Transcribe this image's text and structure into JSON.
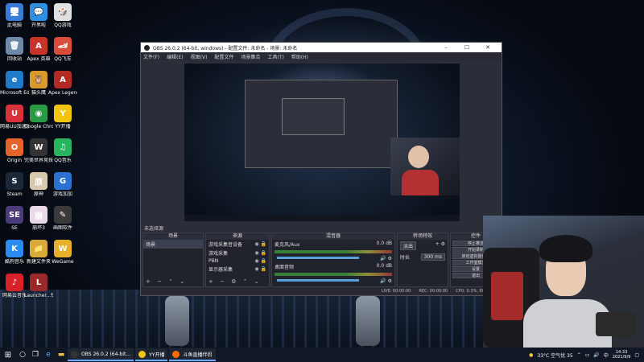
{
  "desktop": {
    "icons": [
      {
        "label": "此电脑",
        "glyph": "🖥",
        "color": "#3a7bd5"
      },
      {
        "label": "开黑啦",
        "glyph": "💬",
        "color": "#2f8fe0"
      },
      {
        "label": "QQ游戏",
        "glyph": "🎲",
        "color": "#e0e0e0"
      },
      {
        "label": "回收站",
        "glyph": "🗑",
        "color": "#6f89a8"
      },
      {
        "label": "Apex 英雄",
        "glyph": "A",
        "color": "#c8332a"
      },
      {
        "label": "QQ飞车",
        "glyph": "🏎",
        "color": "#d84c3a"
      },
      {
        "label": "Microsoft Edge",
        "glyph": "e",
        "color": "#1f7bc8"
      },
      {
        "label": "猫头鹰",
        "glyph": "🦉",
        "color": "#d89a2a"
      },
      {
        "label": "Apex Legends",
        "glyph": "A",
        "color": "#b32a24"
      },
      {
        "label": "网易UU加速器",
        "glyph": "U",
        "color": "#d8323a"
      },
      {
        "label": "Google Chrome",
        "glyph": "◉",
        "color": "#2c9a45"
      },
      {
        "label": "YY开播",
        "glyph": "Y",
        "color": "#f1c40f"
      },
      {
        "label": "Origin",
        "glyph": "O",
        "color": "#e5622a"
      },
      {
        "label": "完美世界竞技平台",
        "glyph": "W",
        "color": "#333333"
      },
      {
        "label": "QQ音乐",
        "glyph": "♫",
        "color": "#29b560"
      },
      {
        "label": "Steam",
        "glyph": "S",
        "color": "#1b2838"
      },
      {
        "label": "原神",
        "glyph": "原",
        "color": "#d8c9ae"
      },
      {
        "label": "游戏加加",
        "glyph": "G",
        "color": "#2b72d0"
      },
      {
        "label": "SE",
        "glyph": "SE",
        "color": "#4a3b7a"
      },
      {
        "label": "崩坏3",
        "glyph": "崩",
        "color": "#e8d8e8"
      },
      {
        "label": "画图软件",
        "glyph": "✎",
        "color": "#3a3a3a"
      },
      {
        "label": "酷狗音乐",
        "glyph": "K",
        "color": "#2b8bf0"
      },
      {
        "label": "新建文件夹",
        "glyph": "📁",
        "color": "#d9a93a"
      },
      {
        "label": "WeGame",
        "glyph": "W",
        "color": "#e8b02a"
      },
      {
        "label": "网易云音乐",
        "glyph": "♪",
        "color": "#d8222a"
      },
      {
        "label": "Launcher...快捷方式",
        "glyph": "L",
        "color": "#9a2a2a"
      }
    ]
  },
  "obs": {
    "title": "OBS 26.0.2 (64-bit, windows) - 配置文件: 未命名 - 场景: 未命名",
    "menu": [
      "文件(F)",
      "编辑(E)",
      "视图(V)",
      "配置文件",
      "场景集合",
      "工具(T)",
      "帮助(H)"
    ],
    "no_source_selected": "未选择源",
    "scenes_title": "场景",
    "scenes": [
      "场景"
    ],
    "sources_title": "来源",
    "sources": [
      "游戏采集音设备",
      "游戏采集",
      "PBN",
      "显示器采集"
    ],
    "mixer_title": "混音器",
    "mixer": [
      {
        "name": "麦克风/Aux",
        "db": "0.0 dB"
      },
      {
        "name": "桌面音频",
        "db": "0.0 dB"
      }
    ],
    "transitions_title": "转场特效",
    "transition_type": "淡出",
    "duration_label": "时长",
    "duration_value": "300 ms",
    "controls_title": "控件",
    "controls": [
      "停止推流",
      "开始录制",
      "启动虚拟摄像机",
      "工作室模式",
      "设置",
      "退出"
    ],
    "status": {
      "live": "LIVE: 00:00:00",
      "rec": "REC: 00:00:00",
      "cpu": "CPU: 0.3%, 60.00 fps"
    }
  },
  "taskbar": {
    "apps": [
      {
        "label": "OBS 26.0.2 (64-bit...",
        "color": "#333"
      },
      {
        "label": "YY开播",
        "color": "#f1c40f"
      },
      {
        "label": "斗鱼直播伴侣",
        "color": "#ff6a00"
      }
    ],
    "weather": "33°C 空气优 35",
    "ime": "中",
    "time": "14:33",
    "date": "2021/9/9"
  }
}
